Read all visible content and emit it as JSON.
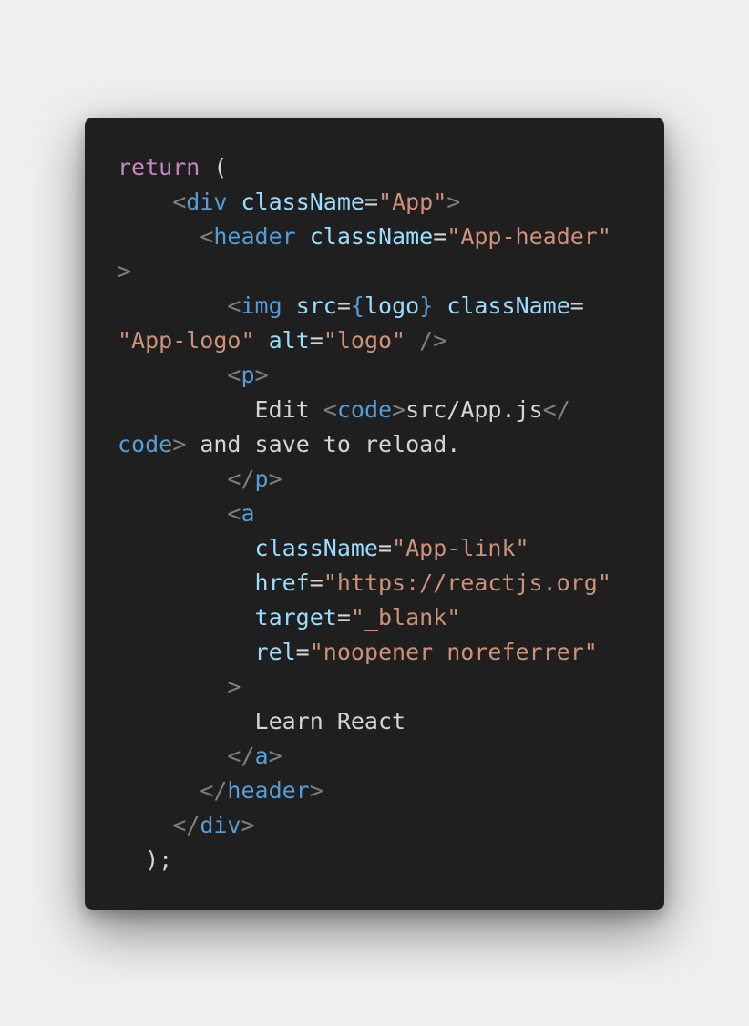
{
  "snippet": {
    "language": "jsx",
    "colors": {
      "background": "#1f1f1f",
      "keyword": "#c586c0",
      "punct": "#808080",
      "tag": "#569cd6",
      "attr": "#9cdcfe",
      "string": "#ce9178",
      "text": "#d4d4d4"
    },
    "lines": [
      [
        {
          "t": "return",
          "k": "keyword"
        },
        {
          "t": " (",
          "k": "plain"
        }
      ],
      [
        {
          "t": "    ",
          "k": "plain"
        },
        {
          "t": "<",
          "k": "punct"
        },
        {
          "t": "div",
          "k": "tag"
        },
        {
          "t": " ",
          "k": "plain"
        },
        {
          "t": "className",
          "k": "attr"
        },
        {
          "t": "=",
          "k": "plain"
        },
        {
          "t": "\"App\"",
          "k": "string"
        },
        {
          "t": ">",
          "k": "punct"
        }
      ],
      [
        {
          "t": "      ",
          "k": "plain"
        },
        {
          "t": "<",
          "k": "punct"
        },
        {
          "t": "header",
          "k": "tag"
        },
        {
          "t": " ",
          "k": "plain"
        },
        {
          "t": "className",
          "k": "attr"
        },
        {
          "t": "=",
          "k": "plain"
        },
        {
          "t": "\"App-header\"",
          "k": "string"
        }
      ],
      [
        {
          "t": ">",
          "k": "punct"
        }
      ],
      [
        {
          "t": "        ",
          "k": "plain"
        },
        {
          "t": "<",
          "k": "punct"
        },
        {
          "t": "img",
          "k": "tag"
        },
        {
          "t": " ",
          "k": "plain"
        },
        {
          "t": "src",
          "k": "attr"
        },
        {
          "t": "=",
          "k": "plain"
        },
        {
          "t": "{",
          "k": "brace"
        },
        {
          "t": "logo",
          "k": "attr"
        },
        {
          "t": "}",
          "k": "brace"
        },
        {
          "t": " ",
          "k": "plain"
        },
        {
          "t": "className",
          "k": "attr"
        },
        {
          "t": "=",
          "k": "plain"
        }
      ],
      [
        {
          "t": "\"App-logo\"",
          "k": "string"
        },
        {
          "t": " ",
          "k": "plain"
        },
        {
          "t": "alt",
          "k": "attr"
        },
        {
          "t": "=",
          "k": "plain"
        },
        {
          "t": "\"logo\"",
          "k": "string"
        },
        {
          "t": " ",
          "k": "plain"
        },
        {
          "t": "/>",
          "k": "punct"
        }
      ],
      [
        {
          "t": "        ",
          "k": "plain"
        },
        {
          "t": "<",
          "k": "punct"
        },
        {
          "t": "p",
          "k": "tag"
        },
        {
          "t": ">",
          "k": "punct"
        }
      ],
      [
        {
          "t": "          Edit ",
          "k": "plain"
        },
        {
          "t": "<",
          "k": "punct"
        },
        {
          "t": "code",
          "k": "tag"
        },
        {
          "t": ">",
          "k": "punct"
        },
        {
          "t": "src/App.js",
          "k": "plain"
        },
        {
          "t": "</",
          "k": "punct"
        }
      ],
      [
        {
          "t": "code",
          "k": "tag"
        },
        {
          "t": ">",
          "k": "punct"
        },
        {
          "t": " and save to reload.",
          "k": "plain"
        }
      ],
      [
        {
          "t": "        ",
          "k": "plain"
        },
        {
          "t": "</",
          "k": "punct"
        },
        {
          "t": "p",
          "k": "tag"
        },
        {
          "t": ">",
          "k": "punct"
        }
      ],
      [
        {
          "t": "        ",
          "k": "plain"
        },
        {
          "t": "<",
          "k": "punct"
        },
        {
          "t": "a",
          "k": "tag"
        }
      ],
      [
        {
          "t": "          ",
          "k": "plain"
        },
        {
          "t": "className",
          "k": "attr"
        },
        {
          "t": "=",
          "k": "plain"
        },
        {
          "t": "\"App-link\"",
          "k": "string"
        }
      ],
      [
        {
          "t": "          ",
          "k": "plain"
        },
        {
          "t": "href",
          "k": "attr"
        },
        {
          "t": "=",
          "k": "plain"
        },
        {
          "t": "\"https://reactjs.org\"",
          "k": "string"
        }
      ],
      [
        {
          "t": "          ",
          "k": "plain"
        },
        {
          "t": "target",
          "k": "attr"
        },
        {
          "t": "=",
          "k": "plain"
        },
        {
          "t": "\"_blank\"",
          "k": "string"
        }
      ],
      [
        {
          "t": "          ",
          "k": "plain"
        },
        {
          "t": "rel",
          "k": "attr"
        },
        {
          "t": "=",
          "k": "plain"
        },
        {
          "t": "\"noopener noreferrer\"",
          "k": "string"
        }
      ],
      [
        {
          "t": "        ",
          "k": "plain"
        },
        {
          "t": ">",
          "k": "punct"
        }
      ],
      [
        {
          "t": "          Learn React",
          "k": "plain"
        }
      ],
      [
        {
          "t": "        ",
          "k": "plain"
        },
        {
          "t": "</",
          "k": "punct"
        },
        {
          "t": "a",
          "k": "tag"
        },
        {
          "t": ">",
          "k": "punct"
        }
      ],
      [
        {
          "t": "      ",
          "k": "plain"
        },
        {
          "t": "</",
          "k": "punct"
        },
        {
          "t": "header",
          "k": "tag"
        },
        {
          "t": ">",
          "k": "punct"
        }
      ],
      [
        {
          "t": "    ",
          "k": "plain"
        },
        {
          "t": "</",
          "k": "punct"
        },
        {
          "t": "div",
          "k": "tag"
        },
        {
          "t": ">",
          "k": "punct"
        }
      ],
      [
        {
          "t": "  );",
          "k": "plain"
        }
      ]
    ]
  }
}
